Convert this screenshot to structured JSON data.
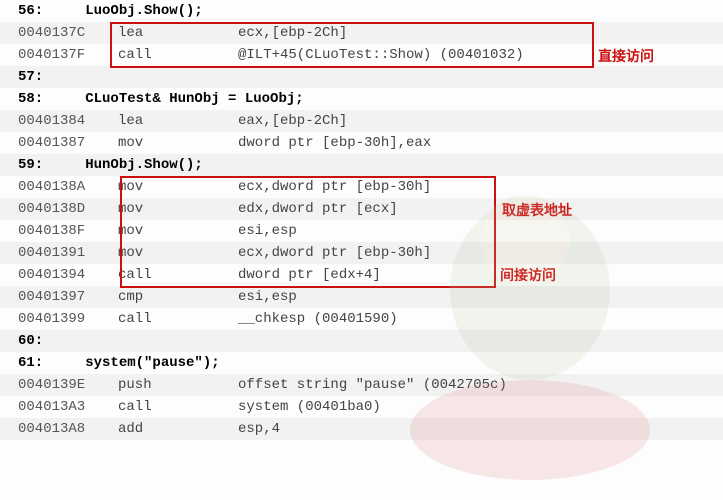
{
  "lines": [
    {
      "type": "src",
      "text": "56:     LuoObj.Show();"
    },
    {
      "type": "asm",
      "addr": "0040137C",
      "opc": "lea",
      "ops": "ecx,[ebp-2Ch]"
    },
    {
      "type": "asm",
      "addr": "0040137F",
      "opc": "call",
      "ops": "@ILT+45(CLuoTest::Show) (00401032)"
    },
    {
      "type": "src",
      "text": "57:"
    },
    {
      "type": "src",
      "text": "58:     CLuoTest& HunObj = LuoObj;"
    },
    {
      "type": "asm",
      "addr": "00401384",
      "opc": "lea",
      "ops": "eax,[ebp-2Ch]"
    },
    {
      "type": "asm",
      "addr": "00401387",
      "opc": "mov",
      "ops": "dword ptr [ebp-30h],eax"
    },
    {
      "type": "src",
      "text": "59:     HunObj.Show();"
    },
    {
      "type": "asm",
      "addr": "0040138A",
      "opc": "mov",
      "ops": "ecx,dword ptr [ebp-30h]"
    },
    {
      "type": "asm",
      "addr": "0040138D",
      "opc": "mov",
      "ops": "edx,dword ptr [ecx]"
    },
    {
      "type": "asm",
      "addr": "0040138F",
      "opc": "mov",
      "ops": "esi,esp"
    },
    {
      "type": "asm",
      "addr": "00401391",
      "opc": "mov",
      "ops": "ecx,dword ptr [ebp-30h]"
    },
    {
      "type": "asm",
      "addr": "00401394",
      "opc": "call",
      "ops": "dword ptr [edx+4]"
    },
    {
      "type": "asm",
      "addr": "00401397",
      "opc": "cmp",
      "ops": "esi,esp"
    },
    {
      "type": "asm",
      "addr": "00401399",
      "opc": "call",
      "ops": "__chkesp (00401590)"
    },
    {
      "type": "src",
      "text": "60:"
    },
    {
      "type": "src",
      "text": "61:     system(\"pause\");"
    },
    {
      "type": "asm",
      "addr": "0040139E",
      "opc": "push",
      "ops": "offset string \"pause\" (0042705c)"
    },
    {
      "type": "asm",
      "addr": "004013A3",
      "opc": "call",
      "ops": "system (00401ba0)"
    },
    {
      "type": "asm",
      "addr": "004013A8",
      "opc": "add",
      "ops": "esp,4"
    }
  ],
  "annotations": {
    "a1": "直接访问",
    "a2": "取虚表地址",
    "a3": "间接访问"
  }
}
